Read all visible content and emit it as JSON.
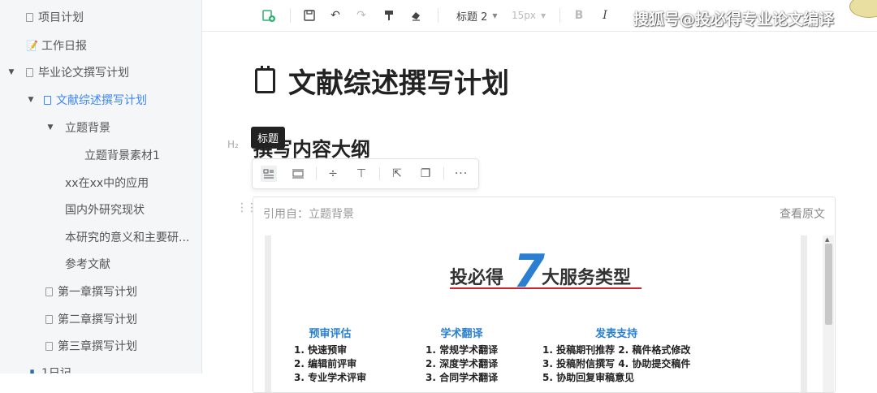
{
  "sidebar": {
    "items": [
      {
        "label": "项目计划",
        "icon": "doc-icon",
        "active": false
      },
      {
        "label": "工作日报",
        "icon": "memo-icon",
        "active": false
      },
      {
        "label": "毕业论文撰写计划",
        "icon": "doc-icon",
        "expanded": true,
        "active": false
      },
      {
        "label": "文献综述撰写计划",
        "icon": "doc-icon",
        "expanded": true,
        "active": true
      },
      {
        "label": "立题背景",
        "expanded": true,
        "active": false
      },
      {
        "label": "立题背景素材1",
        "active": false
      },
      {
        "label": "xx在xx中的应用",
        "active": false
      },
      {
        "label": "国内外研究现状",
        "active": false
      },
      {
        "label": "本研究的意义和主要研...",
        "active": false
      },
      {
        "label": "参考文献",
        "active": false
      },
      {
        "label": "第一章撰写计划",
        "icon": "doc-icon",
        "active": false
      },
      {
        "label": "第二章撰写计划",
        "icon": "doc-icon",
        "active": false
      },
      {
        "label": "第三章撰写计划",
        "icon": "doc-icon",
        "active": false
      },
      {
        "label": "1日记",
        "icon": "book-icon",
        "active": false
      }
    ]
  },
  "toolbar": {
    "heading_select": "标题 2",
    "font_size": "15px",
    "bold": "B",
    "italic": "I"
  },
  "document": {
    "title": "文献综述撰写计划",
    "h2_marker": "H₂",
    "heading": "撰写内容大纲",
    "tooltip": "标题"
  },
  "quote": {
    "source_label": "引用自：立题背景",
    "view_original": "查看原文",
    "poster": {
      "title_left": "投必得",
      "title_number": "7",
      "title_right": "大服务类型",
      "columns": [
        {
          "title": "预审评估",
          "items": [
            "1. 快速预审",
            "2. 编辑前评审",
            "3. 专业学术评审"
          ]
        },
        {
          "title": "学术翻译",
          "items": [
            "1. 常规学术翻译",
            "2. 深度学术翻译",
            "3. 合同学术翻译"
          ]
        },
        {
          "title": "发表支持",
          "items": [
            "1. 投稿期刊推荐  2. 稿件格式修改",
            "3. 投稿附信撰写  4. 协助提交稿件",
            "5. 协助回复审稿意见"
          ]
        }
      ]
    }
  },
  "watermark": "搜狐号@投必得专业论文编译",
  "colors": {
    "accent": "#3b86f7",
    "poster_blue": "#2a7fd1",
    "poster_red": "#c7262e"
  }
}
